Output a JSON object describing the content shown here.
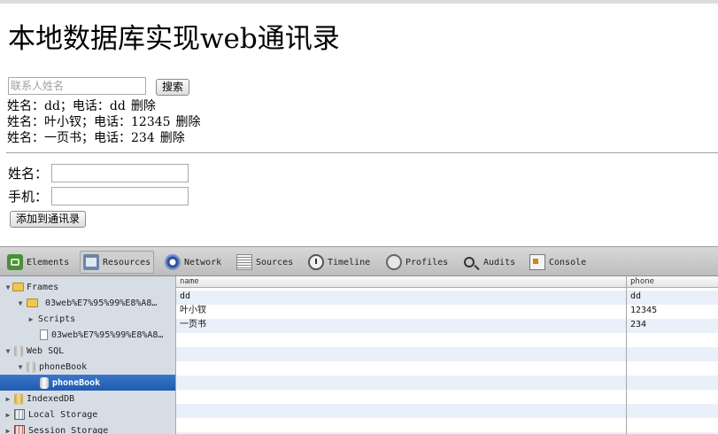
{
  "page": {
    "title": "本地数据库实现web通讯录",
    "search": {
      "placeholder": "联系人姓名",
      "value": "",
      "button_label": "搜索"
    },
    "contacts": [
      {
        "text": "姓名：dd；电话：dd",
        "delete_label": "删除"
      },
      {
        "text": "姓名：叶小钗；电话：12345",
        "delete_label": "删除"
      },
      {
        "text": "姓名：一页书；电话：234",
        "delete_label": "删除"
      }
    ],
    "form": {
      "name_label": "姓名：",
      "phone_label": "手机：",
      "name_value": "",
      "phone_value": "",
      "submit_label": "添加到通讯录"
    }
  },
  "devtools": {
    "tabs": [
      {
        "label": "Elements",
        "icon": "elements-icon"
      },
      {
        "label": "Resources",
        "icon": "resources-icon",
        "active": true
      },
      {
        "label": "Network",
        "icon": "network-icon"
      },
      {
        "label": "Sources",
        "icon": "sources-icon"
      },
      {
        "label": "Timeline",
        "icon": "timeline-icon"
      },
      {
        "label": "Profiles",
        "icon": "profiles-icon"
      },
      {
        "label": "Audits",
        "icon": "audits-icon"
      },
      {
        "label": "Console",
        "icon": "console-icon"
      }
    ],
    "sidebar": {
      "frames": "Frames",
      "frame_page": "03web%E7%95%99%E8%A8…",
      "scripts": "Scripts",
      "frame_doc": "03web%E7%95%99%E8%A8…",
      "web_sql": "Web SQL",
      "db_name": "phoneBook",
      "table_name": "phoneBook",
      "indexeddb": "IndexedDB",
      "local_storage": "Local Storage",
      "session_storage": "Session Storage"
    },
    "table": {
      "columns": [
        "name",
        "phone"
      ],
      "rows": [
        [
          "dd",
          "dd"
        ],
        [
          "叶小钗",
          "12345"
        ],
        [
          "一页书",
          "234"
        ]
      ]
    }
  },
  "colors": {
    "selected_row": "#1f5bb0",
    "sidebar_bg": "#d7dde5",
    "stripe": "#e9f0fa"
  }
}
